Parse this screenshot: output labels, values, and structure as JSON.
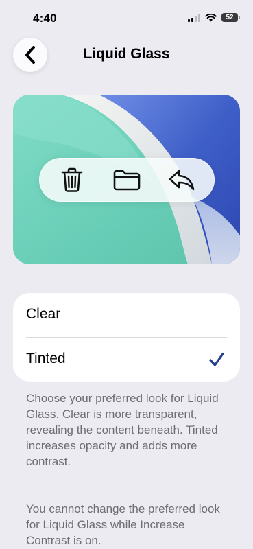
{
  "status_bar": {
    "time": "4:40",
    "battery": "52"
  },
  "nav": {
    "title": "Liquid Glass"
  },
  "preview": {
    "toolbar_icons": [
      "trash-icon",
      "folder-icon",
      "reply-icon"
    ],
    "colors": {
      "mint": "#6fd3bd",
      "blue": "#3f5fc8",
      "silver": "#e4e7ea"
    }
  },
  "options": {
    "items": [
      {
        "label": "Clear",
        "selected": false
      },
      {
        "label": "Tinted",
        "selected": true
      }
    ],
    "accent": "#24408e"
  },
  "footnotes": {
    "description": "Choose your preferred look for Liquid Glass. Clear is more transparent, revealing the content beneath. Tinted increases opacity and adds more contrast.",
    "contrast_note": "You cannot change the preferred look for Liquid Glass while Increase Contrast is on."
  }
}
